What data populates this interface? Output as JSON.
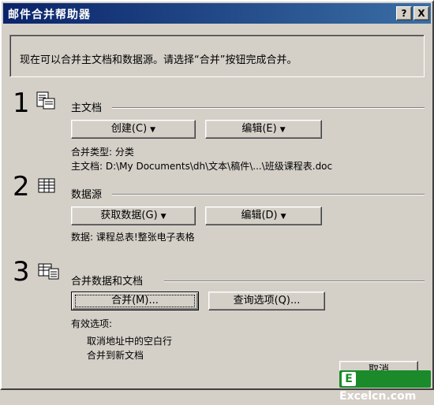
{
  "window": {
    "title": "邮件合并帮助器",
    "help_glyph": "?",
    "close_glyph": "X"
  },
  "intro": "现在可以合并主文档和数据源。请选择“合并”按钮完成合并。",
  "step1": {
    "number": "1",
    "icon": "main-document-icon",
    "label": "主文档",
    "create_button": "创建(C)",
    "edit_button": "编辑(E)",
    "merge_type": "合并类型: 分类",
    "main_doc": "主文档: D:\\My Documents\\dh\\文本\\稿件\\...\\班级课程表.doc"
  },
  "step2": {
    "number": "2",
    "icon": "data-source-icon",
    "label": "数据源",
    "get_data_button": "获取数据(G)",
    "edit_button": "编辑(D)",
    "data_info": "数据: 课程总表!整张电子表格"
  },
  "step3": {
    "number": "3",
    "icon": "merge-icon",
    "label": "合并数据和文档",
    "merge_button": "合并(M)...",
    "query_button": "查询选项(Q)...",
    "options_label": "有效选项:",
    "option_1": "取消地址中的空白行",
    "option_2": "合并到新文档"
  },
  "cancel_button": "取消",
  "watermark": {
    "letter": "E",
    "text": "Excelcn.com"
  }
}
